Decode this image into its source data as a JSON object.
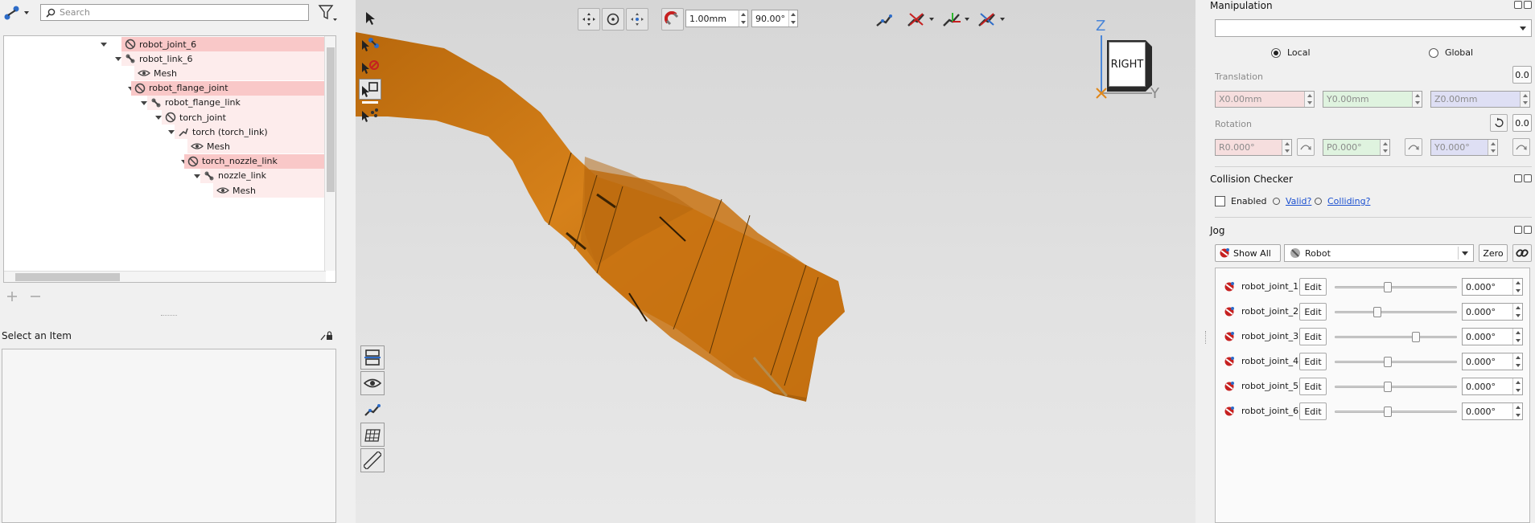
{
  "search": {
    "placeholder": "Search"
  },
  "tree": {
    "items": [
      {
        "label": "robot_joint_6",
        "kind": "joint",
        "state": "selected"
      },
      {
        "label": "robot_link_6",
        "kind": "link",
        "state": "light"
      },
      {
        "label": "Mesh",
        "kind": "mesh",
        "state": "light"
      },
      {
        "label": "robot_flange_joint",
        "kind": "joint",
        "state": "selected"
      },
      {
        "label": "robot_flange_link",
        "kind": "link",
        "state": "light"
      },
      {
        "label": "torch_joint",
        "kind": "joint",
        "state": "light"
      },
      {
        "label": "torch (torch_link)",
        "kind": "tool",
        "state": "light"
      },
      {
        "label": "Mesh",
        "kind": "mesh",
        "state": "light"
      },
      {
        "label": "torch_nozzle_link",
        "kind": "joint",
        "state": "selected"
      },
      {
        "label": "nozzle_link",
        "kind": "link",
        "state": "light"
      },
      {
        "label": "Mesh",
        "kind": "mesh",
        "state": "light"
      }
    ]
  },
  "properties": {
    "title": "Select an Item"
  },
  "viewport": {
    "step_translation": "1.00mm",
    "step_rotation": "90.00°",
    "viewcube": {
      "face": "RIGHT",
      "axis_z": "Z",
      "axis_y": "Y"
    }
  },
  "manipulation": {
    "title": "Manipulation",
    "frame_value": "",
    "local_label": "Local",
    "global_label": "Global",
    "translation_label": "Translation",
    "translation_reset": "0.0",
    "x": "X0.00mm",
    "y": "Y0.00mm",
    "z": "Z0.00mm",
    "rotation_label": "Rotation",
    "rotation_reset": "0.0",
    "r": "R0.000°",
    "p": "P0.000°",
    "yw": "Y0.000°"
  },
  "collision": {
    "title": "Collision Checker",
    "enabled_label": "Enabled",
    "valid_label": "Valid?",
    "colliding_label": "Colliding?"
  },
  "jog": {
    "title": "Jog",
    "show_all_label": "Show All",
    "group_value": "Robot",
    "zero_label": "Zero",
    "edit_label": "Edit",
    "joints": [
      {
        "name": "robot_joint_1",
        "value": "0.000°",
        "slider": 0.42
      },
      {
        "name": "robot_joint_2",
        "value": "0.000°",
        "slider": 0.33
      },
      {
        "name": "robot_joint_3",
        "value": "0.000°",
        "slider": 0.67
      },
      {
        "name": "robot_joint_4",
        "value": "0.000°",
        "slider": 0.42
      },
      {
        "name": "robot_joint_5",
        "value": "0.000°",
        "slider": 0.42
      },
      {
        "name": "robot_joint_6",
        "value": "0.000°",
        "slider": 0.42
      }
    ]
  },
  "colors": {
    "accent_selected": "#f9c8c8",
    "torch": "#c97312",
    "axis_z": "#4a86d8",
    "axis_x": "#e0871a"
  }
}
